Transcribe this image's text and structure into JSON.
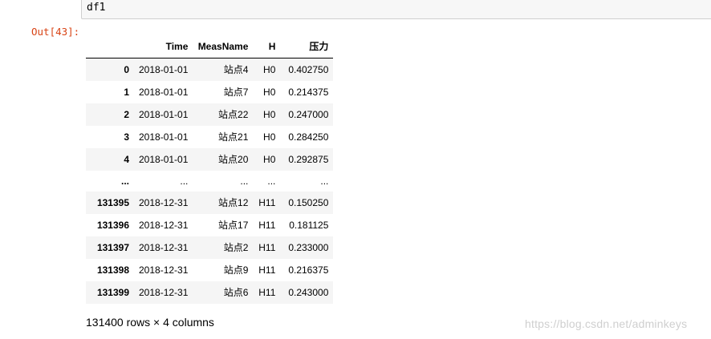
{
  "input": {
    "code": "df1"
  },
  "output": {
    "prompt": "Out[43]:",
    "table": {
      "columns": [
        "",
        "Time",
        "MeasName",
        "H",
        "压力"
      ],
      "rows": [
        {
          "index": "0",
          "time": "2018-01-01",
          "meas": "站点4",
          "h": "H0",
          "p": "0.402750"
        },
        {
          "index": "1",
          "time": "2018-01-01",
          "meas": "站点7",
          "h": "H0",
          "p": "0.214375"
        },
        {
          "index": "2",
          "time": "2018-01-01",
          "meas": "站点22",
          "h": "H0",
          "p": "0.247000"
        },
        {
          "index": "3",
          "time": "2018-01-01",
          "meas": "站点21",
          "h": "H0",
          "p": "0.284250"
        },
        {
          "index": "4",
          "time": "2018-01-01",
          "meas": "站点20",
          "h": "H0",
          "p": "0.292875"
        },
        {
          "index": "...",
          "time": "...",
          "meas": "...",
          "h": "...",
          "p": "..."
        },
        {
          "index": "131395",
          "time": "2018-12-31",
          "meas": "站点12",
          "h": "H11",
          "p": "0.150250"
        },
        {
          "index": "131396",
          "time": "2018-12-31",
          "meas": "站点17",
          "h": "H11",
          "p": "0.181125"
        },
        {
          "index": "131397",
          "time": "2018-12-31",
          "meas": "站点2",
          "h": "H11",
          "p": "0.233000"
        },
        {
          "index": "131398",
          "time": "2018-12-31",
          "meas": "站点9",
          "h": "H11",
          "p": "0.216375"
        },
        {
          "index": "131399",
          "time": "2018-12-31",
          "meas": "站点6",
          "h": "H11",
          "p": "0.243000"
        }
      ]
    },
    "summary": "131400 rows × 4 columns"
  },
  "watermark": "https://blog.csdn.net/adminkeys",
  "colors": {
    "prompt_out": "#d84315",
    "input_bg": "#f7f7f7",
    "row_stripe": "#f5f5f5"
  }
}
